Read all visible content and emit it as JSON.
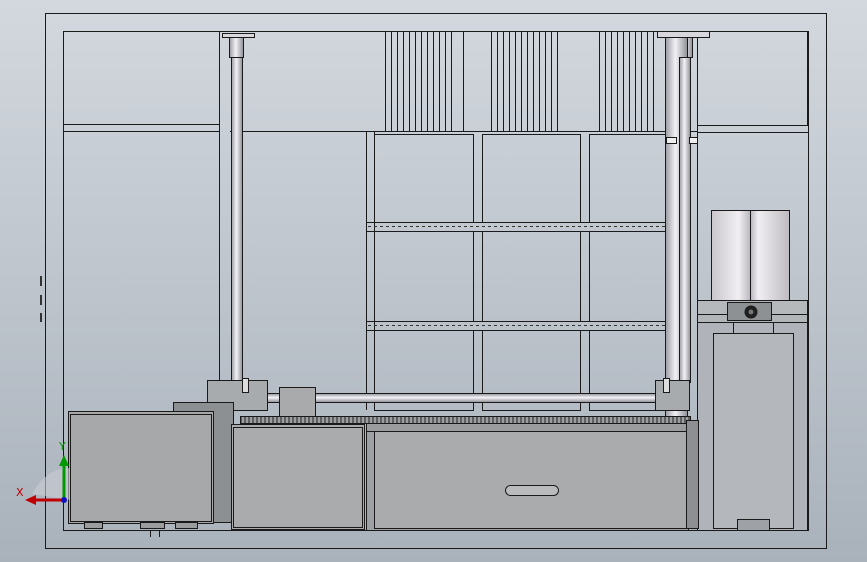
{
  "viewport": {
    "colors": {
      "background_top": "#d3d8de",
      "background_bottom": "#a9b1bb",
      "line": "#1a1a1a",
      "body_fill": "#aab1ba",
      "part_fill": "#a6a8aa",
      "cylinder_light": "#e4e4ea"
    }
  },
  "triad": {
    "x_label": "X",
    "y_label": "Y",
    "x_color": "#c00000",
    "y_color": "#009a00",
    "z_color": "#1010c0"
  }
}
